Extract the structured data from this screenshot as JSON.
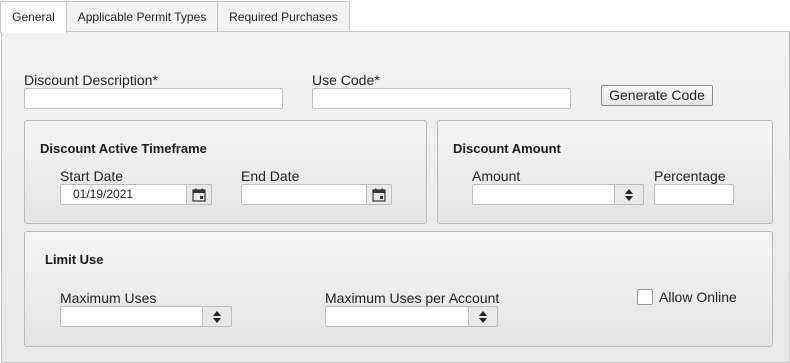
{
  "tabs": [
    {
      "label": "General",
      "active": true
    },
    {
      "label": "Applicable Permit Types",
      "active": false
    },
    {
      "label": "Required Purchases",
      "active": false
    }
  ],
  "general": {
    "discount_description_label": "Discount Description*",
    "discount_description_value": "",
    "use_code_label": "Use Code*",
    "use_code_value": "",
    "generate_code_label": "Generate Code"
  },
  "timeframe": {
    "title": "Discount Active Timeframe",
    "start_date_label": "Start Date",
    "start_date_value": "01/19/2021",
    "end_date_label": "End Date",
    "end_date_value": ""
  },
  "amount": {
    "title": "Discount Amount",
    "amount_label": "Amount",
    "amount_value": "",
    "percentage_label": "Percentage",
    "percentage_value": ""
  },
  "limit": {
    "title": "Limit Use",
    "max_uses_label": "Maximum Uses",
    "max_uses_value": "",
    "max_uses_per_account_label": "Maximum Uses per Account",
    "max_uses_per_account_value": "",
    "allow_online_label": "Allow Online",
    "allow_online_checked": false
  },
  "icons": {
    "calendar": "calendar-icon",
    "spinner": "spinner-icon"
  }
}
